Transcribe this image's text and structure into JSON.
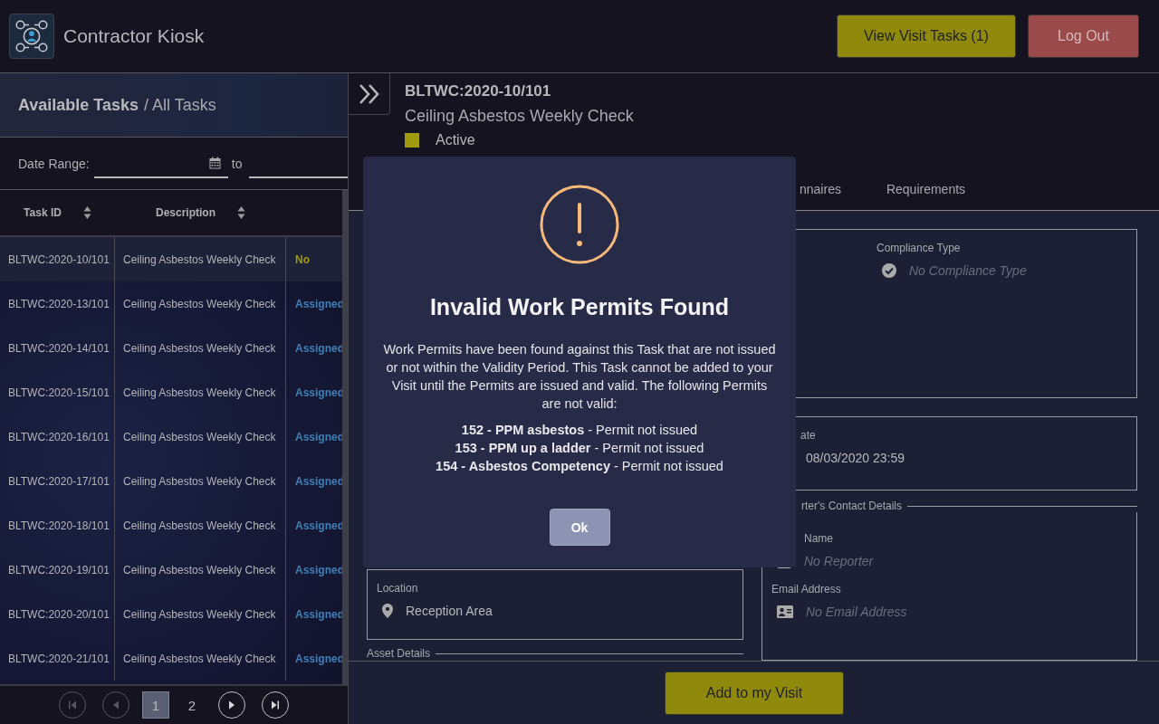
{
  "app": {
    "title": "Contractor Kiosk"
  },
  "header_buttons": [
    {
      "label": "View Visit Tasks (1)",
      "kind": "primary"
    },
    {
      "label": "Log Out",
      "kind": "danger"
    }
  ],
  "task_list": {
    "title": "Available Tasks",
    "subtitle": "/ All Tasks",
    "date_range": {
      "label": "Date Range:",
      "separator": "to"
    },
    "columns": [
      "Task ID",
      "Description"
    ],
    "rows": [
      {
        "task_id": "BLTWC:2020-10/101",
        "description": "Ceiling Asbestos Weekly Check",
        "status": "No",
        "color": "#a09a10",
        "selected": true
      },
      {
        "task_id": "BLTWC:2020-13/101",
        "description": "Ceiling Asbestos Weekly Check",
        "status": "Assigned",
        "color": "#3f7fb5",
        "selected": false
      },
      {
        "task_id": "BLTWC:2020-14/101",
        "description": "Ceiling Asbestos Weekly Check",
        "status": "Assigned",
        "color": "#3f7fb5",
        "selected": false
      },
      {
        "task_id": "BLTWC:2020-15/101",
        "description": "Ceiling Asbestos Weekly Check",
        "status": "Assigned",
        "color": "#3f7fb5",
        "selected": false
      },
      {
        "task_id": "BLTWC:2020-16/101",
        "description": "Ceiling Asbestos Weekly Check",
        "status": "Assigned",
        "color": "#3f7fb5",
        "selected": false
      },
      {
        "task_id": "BLTWC:2020-17/101",
        "description": "Ceiling Asbestos Weekly Check",
        "status": "Assigned",
        "color": "#3f7fb5",
        "selected": false
      },
      {
        "task_id": "BLTWC:2020-18/101",
        "description": "Ceiling Asbestos Weekly Check",
        "status": "Assigned",
        "color": "#3f7fb5",
        "selected": false
      },
      {
        "task_id": "BLTWC:2020-19/101",
        "description": "Ceiling Asbestos Weekly Check",
        "status": "Assigned",
        "color": "#3f7fb5",
        "selected": false
      },
      {
        "task_id": "BLTWC:2020-20/101",
        "description": "Ceiling Asbestos Weekly Check",
        "status": "Assigned",
        "color": "#3f7fb5",
        "selected": false
      },
      {
        "task_id": "BLTWC:2020-21/101",
        "description": "Ceiling Asbestos Weekly Check",
        "status": "Assigned",
        "color": "#3f7fb5",
        "selected": false
      }
    ],
    "pagination": {
      "pages": [
        {
          "label": "1",
          "selected": true
        },
        {
          "label": "2",
          "selected": false
        }
      ],
      "first_disabled": true,
      "prev_disabled": true
    }
  },
  "task_detail": {
    "task_id": "BLTWC:2020-10/101",
    "description": "Ceiling Asbestos Weekly Check",
    "status": {
      "label": "Active",
      "color": "#a09a10"
    },
    "tabs": [
      "nnaires",
      "Requirements"
    ],
    "compliance": {
      "label": "Compliance Type",
      "value": "No Compliance Type"
    },
    "date": {
      "label": "ate",
      "value": "08/03/2020 23:59"
    },
    "location": {
      "label": "Location",
      "value": "Reception Area"
    },
    "asset_legend": "Asset Details",
    "contact": {
      "legend": "rter's Contact Details",
      "name_label": "Name",
      "name_value": "No Reporter",
      "email_label": "Email Address",
      "email_value": "No Email Address"
    },
    "action": "Add to my Visit"
  },
  "dialog": {
    "title": "Invalid Work Permits Found",
    "message": "Work Permits have been found against this Task that are not issued or not within the Validity Period. This Task cannot be added to your Visit until the Permits are issued and valid. The following Permits are not valid:",
    "permits": [
      "**152 - PPM asbestos** - Permit not issued",
      "**153 - PPM up a ladder** - Permit not issued",
      "**154 - Asbestos Competency** - Permit not issued"
    ],
    "button": "Ok"
  }
}
